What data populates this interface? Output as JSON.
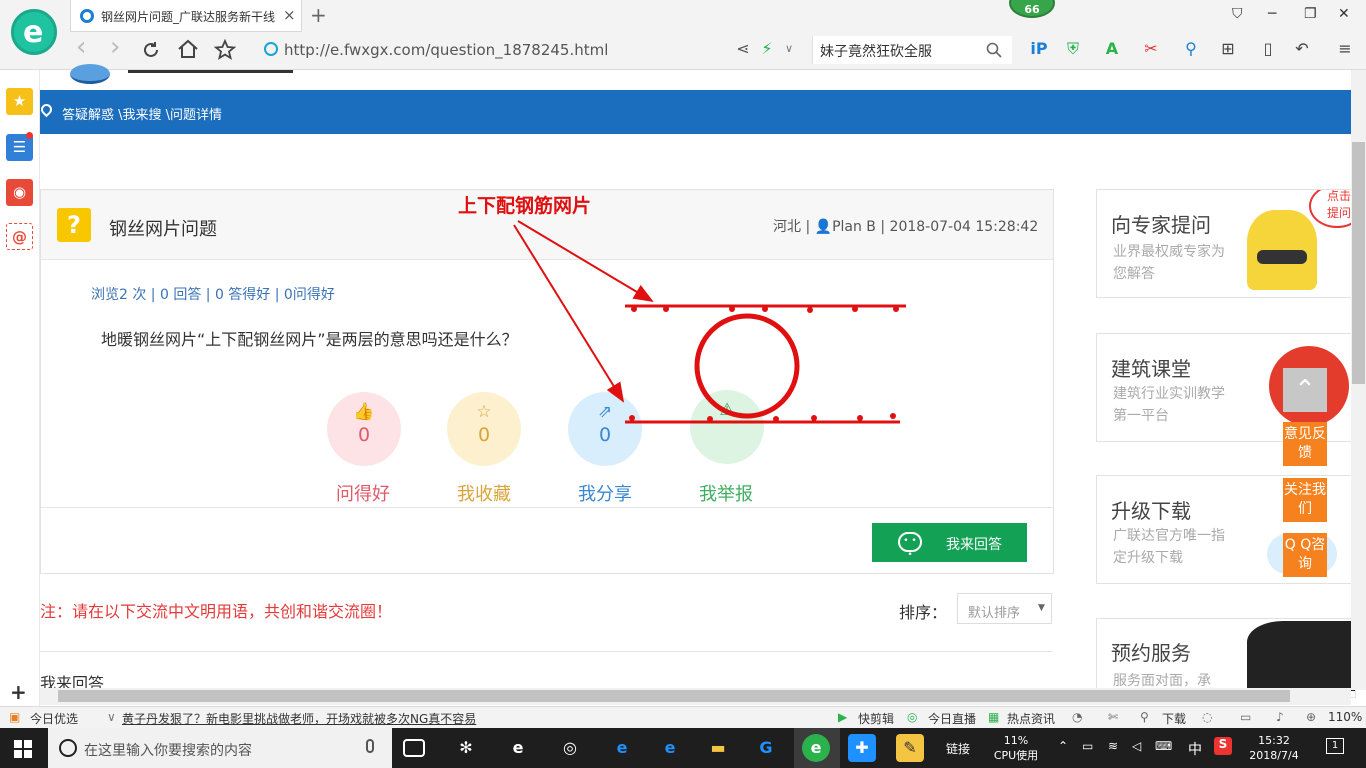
{
  "browser": {
    "logo_letter": "e",
    "tab_title": "钢丝网片问题_广联达服务新干线",
    "tab_close": "×",
    "new_tab": "+",
    "badge": "66",
    "back": "‹",
    "forward": "›",
    "url": "http://e.fwxgx.com/question_1878245.html",
    "search_text": "妹子竟然狂砍全服",
    "win_controls": [
      "⛉",
      "─",
      "❐",
      "✕"
    ]
  },
  "sidebar": {
    "add": "+"
  },
  "page": {
    "breadcrumb": "答疑解惑 \\我来搜 \\问题详情",
    "question": {
      "title": "钢丝网片问题",
      "location": "河北",
      "author": "Plan B",
      "datetime": "2018-07-04 15:28:42",
      "meta_sep": "|",
      "stats": "浏览2 次 | 0 回答 | 0 答得好 | 0问得好",
      "body": "地暖钢丝网片“上下配钢丝网片”是两层的意思吗还是什么？",
      "annotation": "上下配钢筋网片"
    },
    "actions": [
      {
        "label": "问得好",
        "count": "0",
        "icon": "👍",
        "color": "#e05a6a",
        "bg": "#fde3e6"
      },
      {
        "label": "我收藏",
        "count": "0",
        "icon": "☆",
        "color": "#d9a53a",
        "bg": "#fdf0cf"
      },
      {
        "label": "我分享",
        "count": "0",
        "icon": "⇗",
        "color": "#3a88cf",
        "bg": "#d9eefc"
      },
      {
        "label": "我举报",
        "count": "",
        "icon": "⚠",
        "color": "#3fae60",
        "bg": "#ddf4e2"
      }
    ],
    "answer_button": "我来回答",
    "note": "注：请在以下交流中文明用语，共创和谐交流圈！",
    "sort_label": "排序：",
    "sort_value": "默认排序",
    "answers_heading": "我来回答"
  },
  "right_cards": [
    {
      "title": "向专家提问",
      "sub": "业界最权威专家为您解答",
      "bubble": "点击 提问"
    },
    {
      "title": "建筑课堂",
      "sub": "建筑行业实训教学第一平台"
    },
    {
      "title": "升级下载",
      "sub": "广联达官方唯一指定升级下载"
    },
    {
      "title": "预约服务",
      "sub": "服务面对面，承"
    }
  ],
  "float_buttons": {
    "to_top": "⌃",
    "feedback": "意见反馈",
    "follow": "关注我们",
    "qq": "Q Q咨询"
  },
  "statusbar": {
    "left": "今日优选",
    "news": "黄子丹发狠了？新电影里挑战做老师，开场戏就被多次NG真不容易",
    "quick_cut": "快剪辑",
    "live": "今日直播",
    "hot": "热点资讯",
    "download": "下载",
    "zoom": "110%"
  },
  "taskbar": {
    "search_placeholder": "在这里输入你要搜索的内容",
    "links": "链接",
    "cpu_pct": "11%",
    "cpu_label": "CPU使用",
    "ime": "中",
    "time": "15:32",
    "date": "2018/7/4",
    "notify_count": "1"
  }
}
